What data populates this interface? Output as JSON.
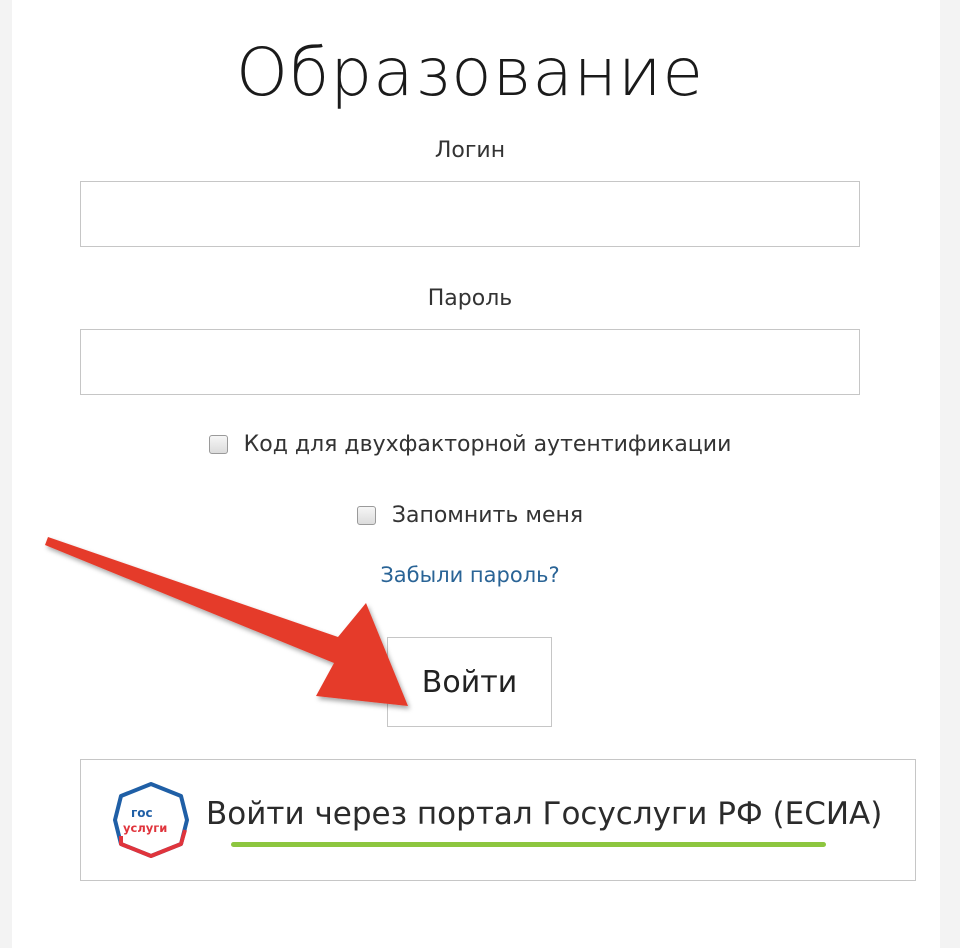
{
  "header": {
    "title": "Образование"
  },
  "form": {
    "login_label": "Логин",
    "login_value": "",
    "password_label": "Пароль",
    "password_value": "",
    "two_factor_label": "Код для двухфакторной аутентификации",
    "remember_label": "Запомнить меня",
    "forgot_label": "Забыли пароль?",
    "submit_label": "Войти"
  },
  "esia": {
    "logo_line1": "гос",
    "logo_line2": "услуги",
    "label": "Войти через портал Госуслуги РФ (ЕСИА)"
  },
  "colors": {
    "link": "#2a6496",
    "arrow": "#e53a2c",
    "underline": "#8dc63f",
    "logo_blue": "#1f5fa6",
    "logo_red": "#e0343c"
  },
  "icons": {
    "arrow": "red-arrow-icon",
    "logo": "gosuslugi-logo-icon"
  }
}
